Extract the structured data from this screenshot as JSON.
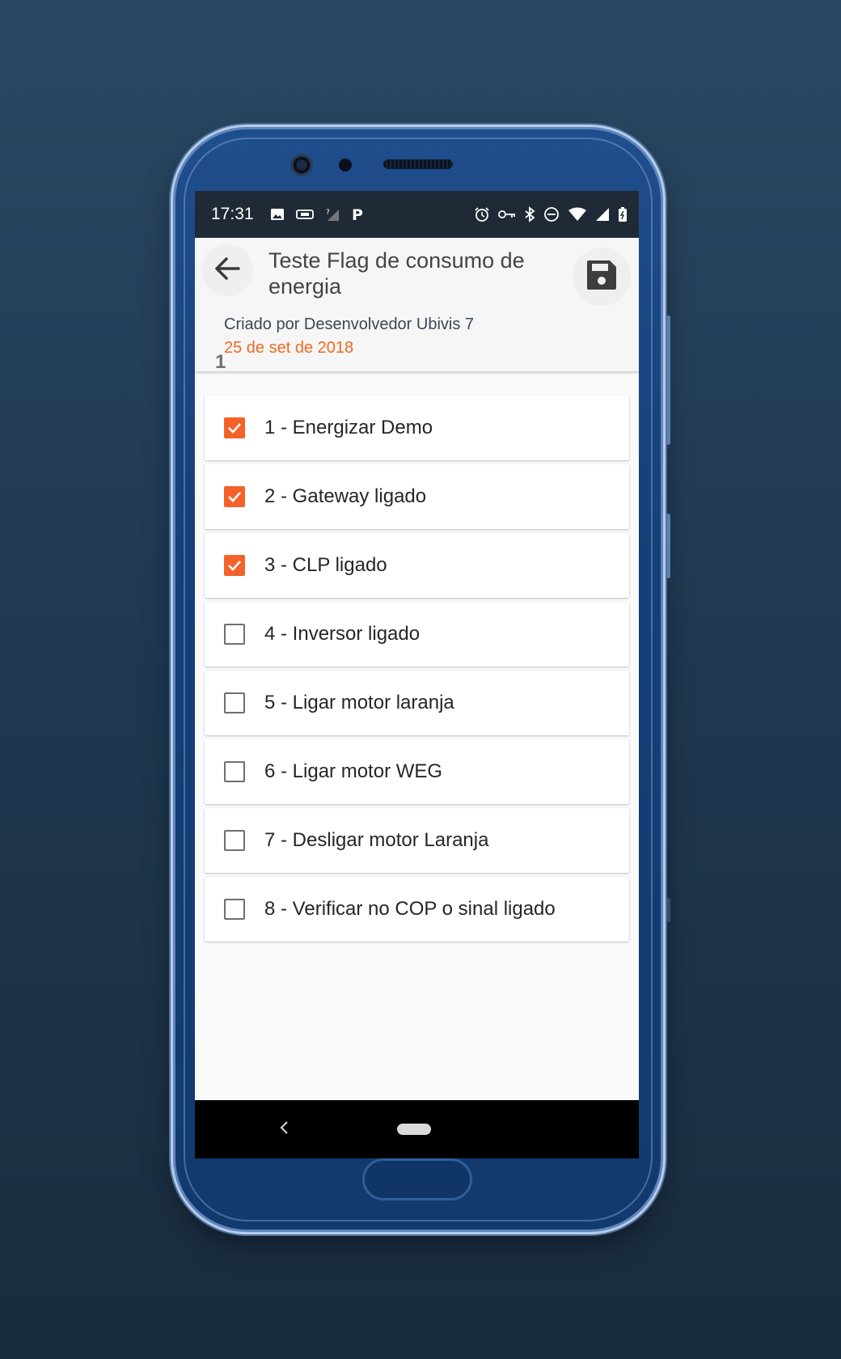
{
  "status_bar": {
    "time": "17:31",
    "left_icons": [
      "image-icon",
      "cast-icon",
      "signal-unknown-icon",
      "p-app-icon"
    ],
    "right_icons": [
      "alarm-icon",
      "key-icon",
      "bluetooth-icon",
      "dnd-icon",
      "wifi-icon",
      "signal-icon",
      "battery-icon"
    ],
    "p_glyph": "P"
  },
  "header": {
    "title": "Teste Flag de consumo de energia",
    "creator": "Criado por Desenvolvedor Ubivis 7",
    "date": "25 de set de 2018",
    "back_icon": "arrow-left-icon",
    "save_icon": "floppy-disk-icon"
  },
  "section": {
    "label": "1"
  },
  "checklist": {
    "items": [
      {
        "label": "1 - Energizar Demo",
        "checked": true
      },
      {
        "label": "2 - Gateway ligado",
        "checked": true
      },
      {
        "label": "3 - CLP ligado",
        "checked": true
      },
      {
        "label": "4 - Inversor ligado",
        "checked": false
      },
      {
        "label": "5 - Ligar motor laranja",
        "checked": false
      },
      {
        "label": "6 - Ligar motor WEG",
        "checked": false
      },
      {
        "label": "7 - Desligar motor Laranja",
        "checked": false
      },
      {
        "label": "8 - Verificar no COP o sinal ligado",
        "checked": false
      }
    ]
  },
  "colors": {
    "accent": "#f4622a",
    "date_text": "#f2691f",
    "phone_body": "#143f77",
    "background": "#1f3850"
  }
}
